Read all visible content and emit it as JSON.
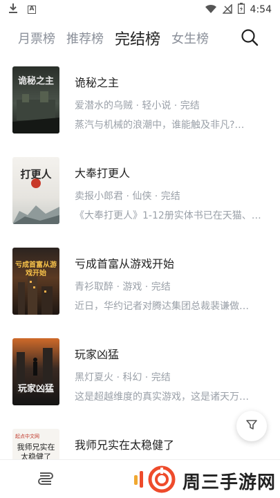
{
  "status_bar": {
    "time": "4:54",
    "icons": [
      "download-icon",
      "a-notification-icon",
      "wifi-icon",
      "no-signal-icon",
      "battery-icon"
    ]
  },
  "nav": {
    "tabs": [
      {
        "label": "月票榜",
        "active": false
      },
      {
        "label": "推荐榜",
        "active": false
      },
      {
        "label": "完结榜",
        "active": true
      },
      {
        "label": "女生榜",
        "active": false
      }
    ]
  },
  "books": [
    {
      "title": "诡秘之主",
      "meta": "爱潜水的乌贼 · 轻小说 · 完结",
      "desc": "蒸汽与机械的浪潮中，谁能触及非凡?…",
      "cover_text": "诡秘之主"
    },
    {
      "title": "大奉打更人",
      "meta": "卖报小郎君 · 仙侠 · 完结",
      "desc": "《大奉打更人》1-12册实体书已在天猫、…",
      "cover_text": "打更人"
    },
    {
      "title": "亏成首富从游戏开始",
      "meta": "青衫取醉 · 游戏 · 完结",
      "desc": "近日，华约记者对腾达集团总裁裴谦做…",
      "cover_text": "亏成首富从游戏开始"
    },
    {
      "title": "玩家凶猛",
      "meta": "黑灯夏火 · 科幻 · 完结",
      "desc": "这是超越维度的真实游戏，这是诸天万…",
      "cover_text": "玩家凶猛"
    },
    {
      "title": "我师兄实在太稳健了",
      "meta": "",
      "desc": "",
      "cover_text": "我师兄实在太稳健了",
      "cover_brand": "起点中文网"
    }
  ],
  "watermark": {
    "text": "周三手游网"
  },
  "colors": {
    "accent": "#ee4b2b",
    "muted_text": "#9aa0a8"
  }
}
